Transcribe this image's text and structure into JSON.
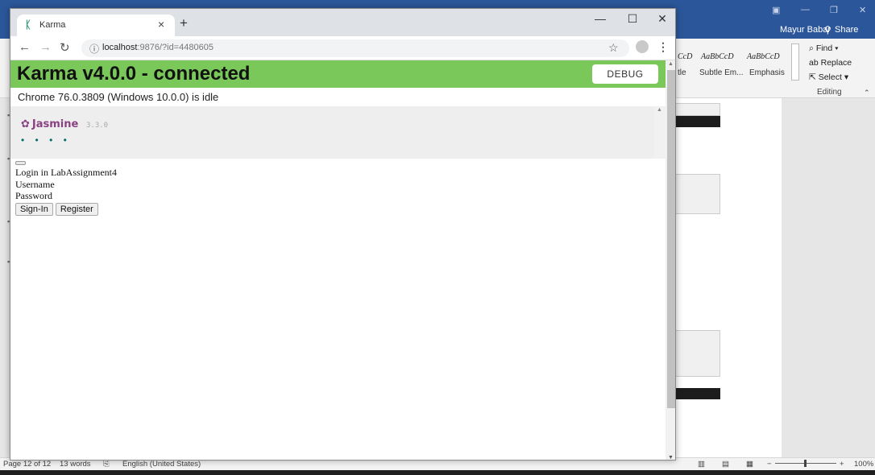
{
  "word": {
    "user_name": "Mayur Babar",
    "share_label": "Share",
    "styles": [
      {
        "preview": "CcD",
        "name": "tle"
      },
      {
        "preview": "AaBbCcD",
        "name": "Subtle Em..."
      },
      {
        "preview": "AaBbCcD",
        "name": "Emphasis"
      }
    ],
    "editing": {
      "find_label": "Find",
      "replace_label": "Replace",
      "select_label": "Select",
      "group_label": "Editing"
    },
    "status": {
      "page": "Page 12 of 12",
      "words": "13 words",
      "language": "English (United States)",
      "zoom": "100%"
    }
  },
  "chrome": {
    "tab_title": "Karma",
    "url_host": "localhost",
    "url_rest": ":9876/?id=4480605"
  },
  "karma": {
    "title": "Karma v4.0.0 - connected",
    "debug_label": "DEBUG",
    "browser_status": "Chrome 76.0.3809 (Windows 10.0.0) is idle"
  },
  "jasmine": {
    "logo": "Jasmine",
    "version": "3.3.0",
    "dots": "• • • •"
  },
  "app": {
    "heading": "Login in LabAssignment4",
    "username_label": "Username",
    "password_label": "Password",
    "signin_label": "Sign-In",
    "register_label": "Register"
  },
  "colors": {
    "word_blue": "#2b579a",
    "karma_green": "#7ac75a",
    "jasmine_purple": "#8a4182",
    "tab_strip": "#dee1e6"
  }
}
